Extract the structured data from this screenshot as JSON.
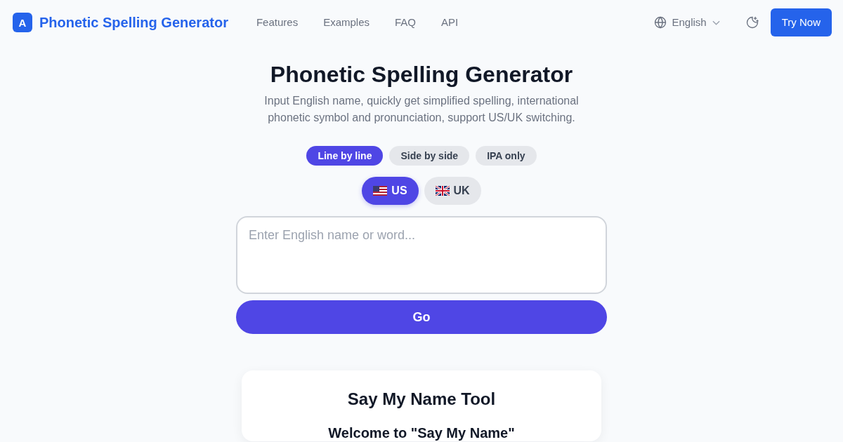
{
  "header": {
    "logo_letter": "A",
    "brand": "Phonetic Spelling Generator",
    "nav": [
      "Features",
      "Examples",
      "FAQ",
      "API"
    ],
    "language": "English",
    "cta": "Try Now"
  },
  "hero": {
    "title": "Phonetic Spelling Generator",
    "subtitle": "Input English name, quickly get simplified spelling, international phonetic symbol and pronunciation, support US/UK switching."
  },
  "layout_modes": [
    {
      "label": "Line by line",
      "selected": true
    },
    {
      "label": "Side by side",
      "selected": false
    },
    {
      "label": "IPA only",
      "selected": false
    }
  ],
  "accents": [
    {
      "kind": "us",
      "label": "US",
      "selected": true
    },
    {
      "kind": "uk",
      "label": "UK",
      "selected": false
    }
  ],
  "input": {
    "placeholder": "Enter English name or word..."
  },
  "go_button": "Go",
  "tool_card": {
    "title": "Say My Name Tool",
    "heading": "Welcome to \"Say My Name\""
  }
}
